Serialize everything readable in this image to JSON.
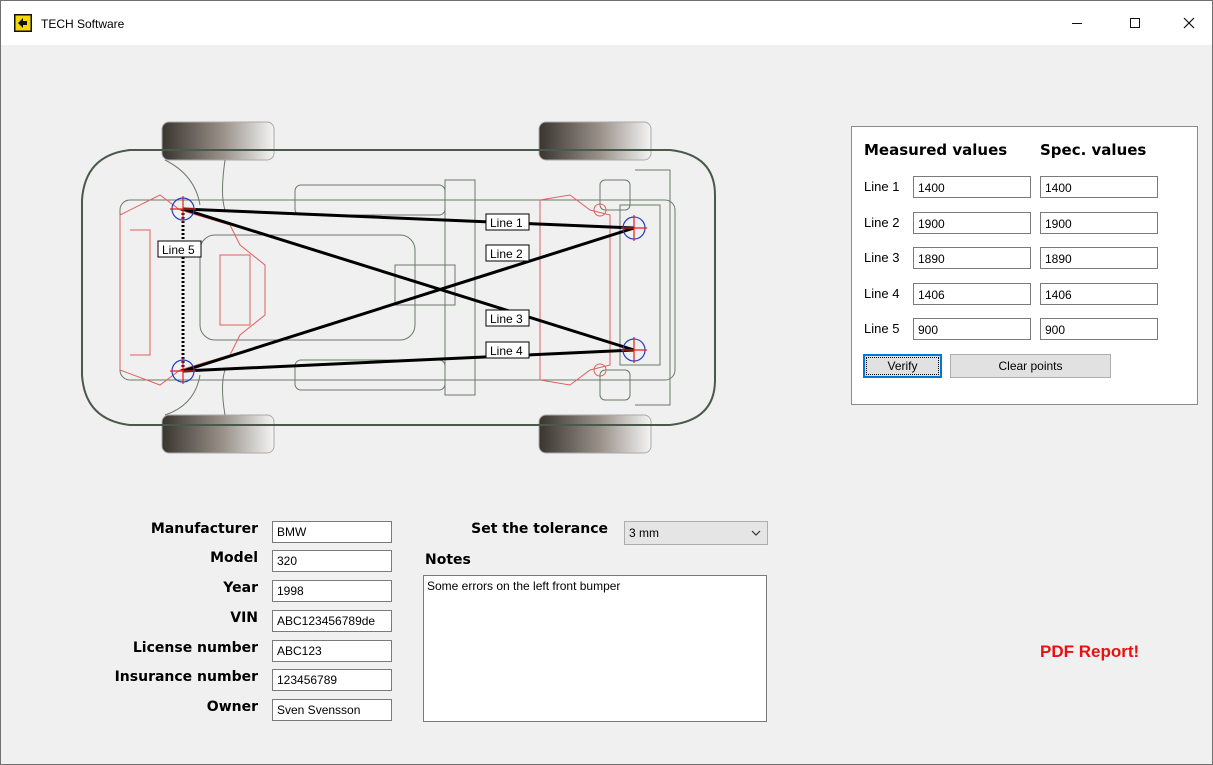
{
  "window": {
    "title": "TECH Software",
    "min_icon": "minimize-icon",
    "max_icon": "maximize-icon",
    "close_icon": "close-icon"
  },
  "diagram": {
    "line_labels": [
      "Line 1",
      "Line 2",
      "Line 3",
      "Line 4",
      "Line 5"
    ]
  },
  "panel": {
    "measured_header": "Measured values",
    "spec_header": "Spec. values",
    "rows": [
      {
        "label": "Line 1",
        "measured": "1400",
        "spec": "1400"
      },
      {
        "label": "Line 2",
        "measured": "1900",
        "spec": "1900"
      },
      {
        "label": "Line 3",
        "measured": "1890",
        "spec": "1890"
      },
      {
        "label": "Line 4",
        "measured": "1406",
        "spec": "1406"
      },
      {
        "label": "Line 5",
        "measured": "900",
        "spec": "900"
      }
    ],
    "verify_label": "Verify",
    "clear_label": "Clear points"
  },
  "form": {
    "manufacturer_label": "Manufacturer",
    "manufacturer": "BMW",
    "model_label": "Model",
    "model": "320",
    "year_label": "Year",
    "year": "1998",
    "vin_label": "VIN",
    "vin": "ABC123456789de",
    "license_label": "License number",
    "license": "ABC123",
    "insurance_label": "Insurance number",
    "insurance": "123456789",
    "owner_label": "Owner",
    "owner": "Sven Svensson"
  },
  "tolerance": {
    "label": "Set the tolerance",
    "value": "3 mm"
  },
  "notes": {
    "label": "Notes",
    "text": "Some errors on the left front bumper"
  },
  "pdf_label": "PDF Report!",
  "colors": {
    "accent": "#0078d7",
    "pdf": "#e81010",
    "marker_red": "#e02020",
    "marker_blue": "#2040c0"
  }
}
